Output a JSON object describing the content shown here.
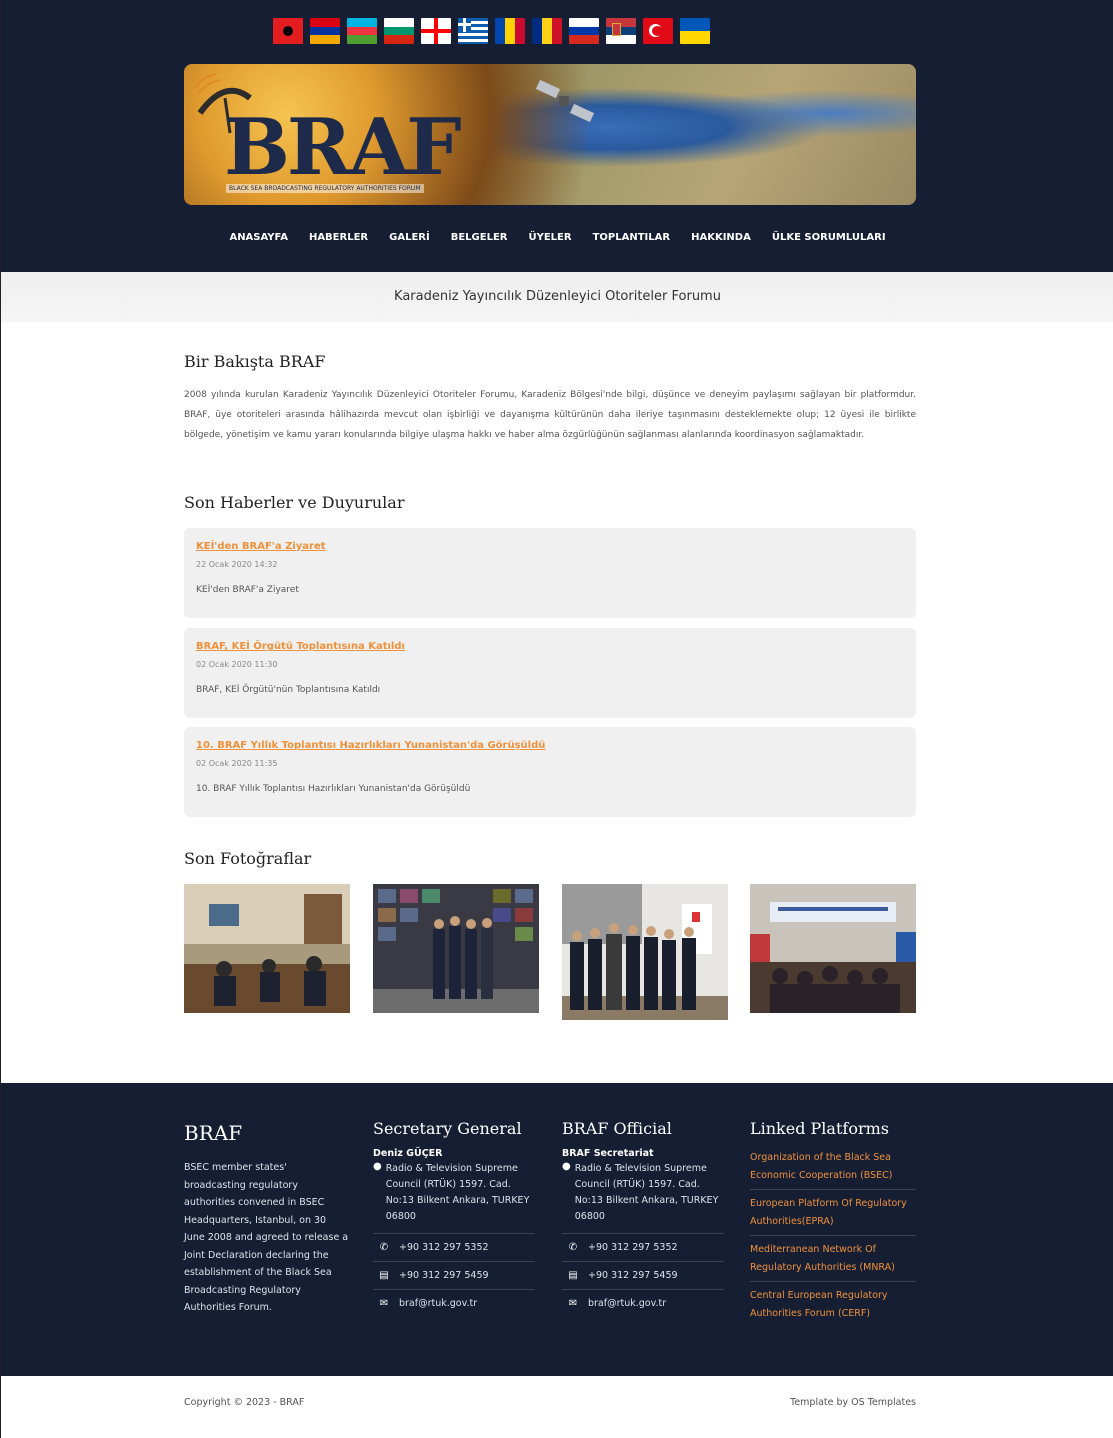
{
  "header": {
    "flags": [
      {
        "name": "albania-flag",
        "colors": [
          "#e41e20",
          "#e41e20"
        ]
      },
      {
        "name": "armenia-flag",
        "colors": [
          "#d90012",
          "#0033a0",
          "#f2a800"
        ]
      },
      {
        "name": "azerbaijan-flag",
        "colors": [
          "#00b5e2",
          "#ef3340",
          "#509e2f"
        ]
      },
      {
        "name": "bulgaria-flag",
        "colors": [
          "#ffffff",
          "#00966e",
          "#d62612"
        ]
      },
      {
        "name": "georgia-flag",
        "colors": [
          "#ffffff",
          "#ff0000"
        ]
      },
      {
        "name": "greece-flag",
        "colors": [
          "#0d5eaf",
          "#ffffff"
        ]
      },
      {
        "name": "moldova-flag",
        "colors": [
          "#0046ae",
          "#ffd200",
          "#cc092f"
        ]
      },
      {
        "name": "romania-flag",
        "colors": [
          "#002b7f",
          "#fcd116",
          "#ce1126"
        ]
      },
      {
        "name": "russia-flag",
        "colors": [
          "#ffffff",
          "#0039a6",
          "#d52b1e"
        ]
      },
      {
        "name": "serbia-flag",
        "colors": [
          "#c6363c",
          "#0c4076",
          "#ffffff"
        ]
      },
      {
        "name": "turkey-flag",
        "colors": [
          "#e30a17",
          "#e30a17"
        ]
      },
      {
        "name": "ukraine-flag",
        "colors": [
          "#0057b7",
          "#ffd700"
        ]
      }
    ],
    "logo": {
      "text": "BRAF",
      "sub": "BLACK SEA BROADCASTING REGULATORY AUTHORITIES FORUM"
    },
    "nav": [
      "ANASAYFA",
      "HABERLER",
      "GALERİ",
      "BELGELER",
      "ÜYELER",
      "TOPLANTILAR",
      "HAKKINDA",
      "ÜLKE SORUMLULARI"
    ]
  },
  "subtitle": "Karadeniz Yayıncılık Düzenleyici Otoriteler Forumu",
  "about": {
    "title": "Bir Bakışta BRAF",
    "text": "2008 yılında kurulan Karadeniz Yayıncılık Düzenleyici Otoriteler Forumu, Karadeniz Bölgesi'nde bilgi, düşünce ve deneyim paylaşımı sağlayan bir platformdur. BRAF, üye otoriteleri arasında hâlihazırda mevcut olan işbirliği ve dayanışma kültürünün daha ileriye taşınmasını desteklemekte olup; 12 üyesi ile birlikte bölgede, yönetişim ve kamu yararı konularında bilgiye ulaşma hakkı ve haber alma özgürlüğünün sağlanması alanlarında koordinasyon sağlamaktadır."
  },
  "news": {
    "title": "Son Haberler ve Duyurular",
    "items": [
      {
        "title": "KEİ'den BRAF'a Ziyaret",
        "date": "22 Ocak 2020 14:32",
        "summary": "KEİ'den BRAF'a Ziyaret"
      },
      {
        "title": "BRAF, KEİ Örgütü Toplantısına Katıldı",
        "date": "02 Ocak 2020 11:30",
        "summary": "BRAF, KEİ Örgütü'nün Toplantısına Katıldı"
      },
      {
        "title": "10. BRAF Yıllık Toplantısı Hazırlıkları Yunanistan'da Görüşüldü",
        "date": "02 Ocak 2020 11:35",
        "summary": "10. BRAF Yıllık Toplantısı Hazırlıkları Yunanistan'da Görüşüldü"
      }
    ]
  },
  "photos": {
    "title": "Son Fotoğraflar"
  },
  "footer": {
    "about_title": "BRAF",
    "about_text": "BSEC member states' broadcasting regulatory authorities convened in BSEC Headquarters, Istanbul, on 30 June 2008 and agreed to release a Joint Declaration declaring the establishment of the Black Sea Broadcasting Regulatory Authorities Forum.",
    "sg": {
      "title": "Secretary General",
      "name": "Deniz GÜÇER",
      "address": "Radio & Television Supreme Council (RTÜK) 1597. Cad. No:13 Bilkent Ankara, TURKEY 06800",
      "phone": "+90 312 297 5352",
      "fax": "+90 312 297 5459",
      "email": "braf@rtuk.gov.tr"
    },
    "official": {
      "title": "BRAF Official",
      "name": "BRAF Secretariat",
      "address": "Radio & Television Supreme Council (RTÜK) 1597. Cad. No:13 Bilkent Ankara, TURKEY 06800",
      "phone": "+90 312 297 5352",
      "fax": "+90 312 297 5459",
      "email": "braf@rtuk.gov.tr"
    },
    "links_title": "Linked Platforms",
    "links": [
      "Organization of the Black Sea Economic Cooperation (BSEC)",
      "European Platform Of Regulatory Authorities(EPRA)",
      "Mediterranean Network Of Regulatory Authorities (MNRA)",
      "Central European Regulatory Authorities Forum (CERF)"
    ]
  },
  "bottom": {
    "copyright": "Copyright © 2023 - BRAF",
    "template": "Template by OS Templates"
  }
}
